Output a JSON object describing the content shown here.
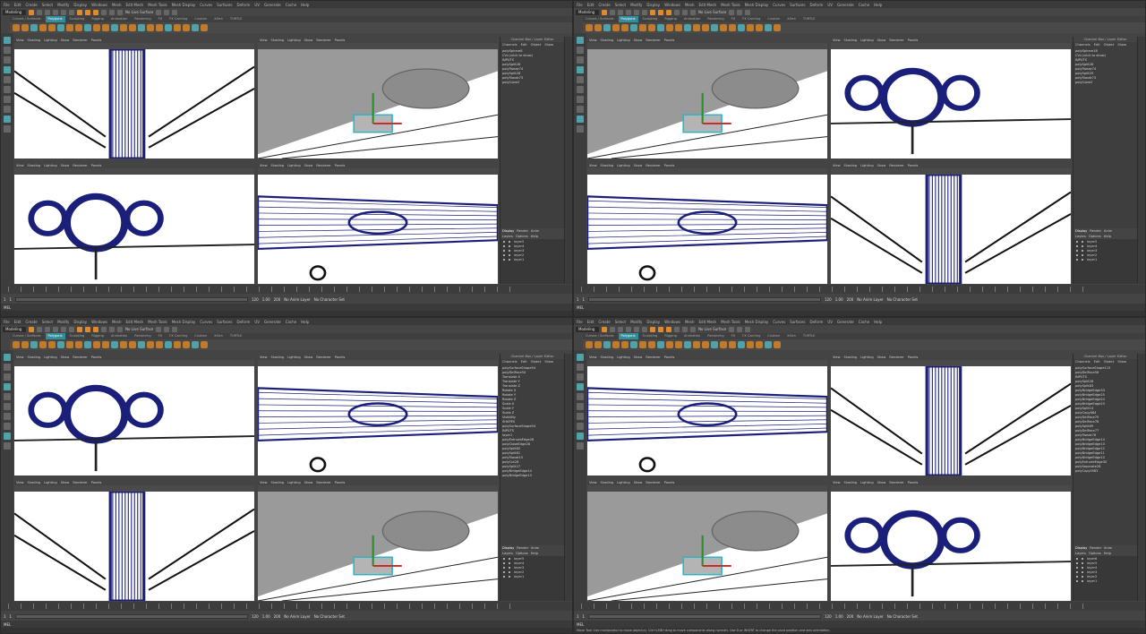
{
  "menus": [
    "File",
    "Edit",
    "Create",
    "Select",
    "Modify",
    "Display",
    "Windows",
    "Mesh",
    "Edit Mesh",
    "Mesh Tools",
    "Mesh Display",
    "Curves",
    "Surfaces",
    "Deform",
    "UV",
    "Generate",
    "Cache",
    "Help"
  ],
  "mode": "Modeling",
  "live_surface": "No Live Surface",
  "shelf_tabs": [
    "Curves / Surfaces",
    "Polygons",
    "Sculpting",
    "Rigging",
    "Animation",
    "Rendering",
    "FX",
    "FX Caching",
    "Custom",
    "XGen",
    "TURTLE"
  ],
  "active_shelf_tab": "Polygons",
  "viewport_menu": [
    "View",
    "Shading",
    "Lighting",
    "Show",
    "Renderer",
    "Panels"
  ],
  "channel_box": {
    "title": "Channel Box / Layer Editor",
    "menu": [
      "Channels",
      "Edit",
      "Object",
      "Show"
    ],
    "layer_tabs": [
      "Display",
      "Render",
      "Anim"
    ],
    "layer_menu": [
      "Layers",
      "Options",
      "Help"
    ]
  },
  "windows": [
    {
      "objects": [
        "polySphere8",
        "CVs (click to show)",
        "INPUTS",
        "polySplit28",
        "polyTweak74",
        "polySplit28",
        "polyTweak73",
        "polyCube2"
      ],
      "layers": [
        "layer5",
        "layer4",
        "layer3",
        "layer2",
        "layer1"
      ]
    },
    {
      "objects": [
        "polySphere18",
        "CVs (click to show)",
        "INPUTS",
        "polySplit28",
        "polyTweak74",
        "polySplit29",
        "polyTweak73",
        "polyCube2"
      ],
      "layers": [
        "layer5",
        "layer4",
        "layer3",
        "layer2",
        "layer1"
      ]
    },
    {
      "objects": [
        "polySurfaceShape54",
        "polyDelFace54",
        "Translate X",
        "Translate Y",
        "Translate Z",
        "Rotate X",
        "Rotate Y",
        "Rotate Z",
        "Scale X",
        "Scale Y",
        "Scale Z",
        "Visibility",
        "SHAPES",
        "polySurfaceShape54",
        "INPUTS",
        "layer1",
        "polyExtrudeEdge28",
        "polyCloseEdge28",
        "polySplit82",
        "polySplit81",
        "polyTweak10",
        "polyCut28",
        "polySplit27",
        "polyBridgeEdge14",
        "polyBridgeEdge13"
      ],
      "layers": [
        "layer5",
        "layer4",
        "layer3",
        "layer2",
        "layer1"
      ]
    },
    {
      "objects": [
        "polySurfaceShape115",
        "polyDelFace56",
        "INPUTS",
        "polySplit28",
        "polySplit83",
        "polyBridgeEdge33",
        "polyBridgeEdge25",
        "polyBridgeEdge24",
        "polyBridgeEdge23",
        "polySplit14",
        "polyCopy084",
        "polyDelFace79",
        "polyDelFace78",
        "polySplit69",
        "polyDelFace77",
        "polyTweak76",
        "polyBridgeEdge14",
        "polyBridgeEdge13",
        "polyBridgeEdge12",
        "polyBridgeEdge11",
        "polyBridgeEdge10",
        "polyExtrudeEdge30",
        "polySeparate28",
        "polyCopyOf83"
      ],
      "layers": [
        "layer6",
        "layer5",
        "layer4",
        "layer3",
        "layer2",
        "layer1"
      ]
    }
  ],
  "timeline": {
    "start": "1",
    "end": "120",
    "range_start": "1.00",
    "range_end": "200",
    "current_frame": "1",
    "anim_layer": "No Anim Layer",
    "char_set": "No Character Set"
  },
  "cmd_label": "MEL",
  "help_text": "Move Tool: Use manipulator to move object(s). Ctrl+LMB+drag to move components along normals. Use D or INSERT to change the pivot position and axis orientation.",
  "colors": {
    "accent": "#2f8f9d",
    "orange": "#e08a2c",
    "wire": "#1a1f7a",
    "panel": "#444444"
  }
}
